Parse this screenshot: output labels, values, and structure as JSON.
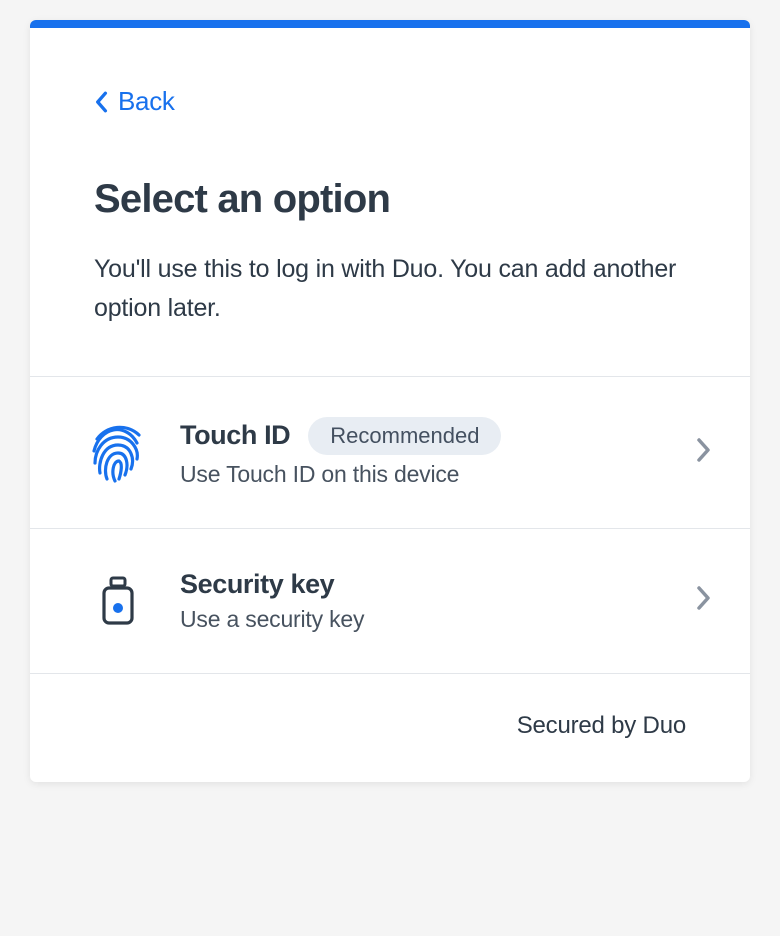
{
  "back_label": "Back",
  "title": "Select an option",
  "description": "You'll use this to log in with Duo. You can add another option later.",
  "options": [
    {
      "title": "Touch ID",
      "subtitle": "Use Touch ID on this device",
      "badge": "Recommended"
    },
    {
      "title": "Security key",
      "subtitle": "Use a security key",
      "badge": null
    }
  ],
  "footer_text": "Secured by Duo"
}
